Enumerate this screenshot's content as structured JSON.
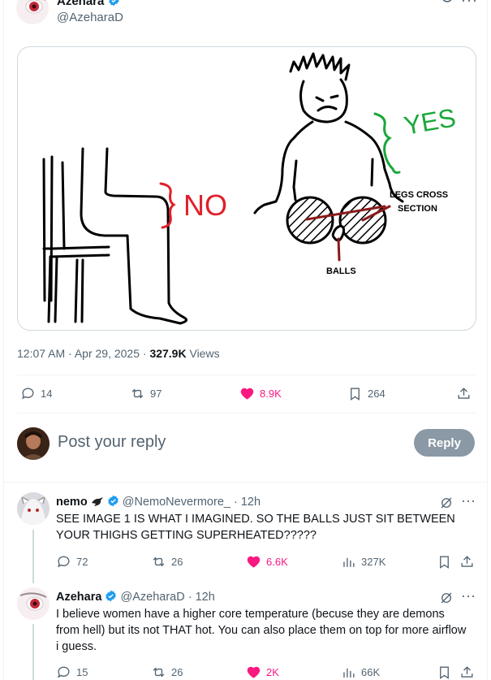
{
  "main_post": {
    "author_name": "Azehara",
    "author_handle": "@AzeharaD",
    "timestamp": "12:07 AM · Apr 29, 2025 · ",
    "views_count": "327.9K",
    "views_label": " Views",
    "actions": {
      "replies": "14",
      "reposts": "97",
      "likes": "8.9K",
      "bookmarks": "264"
    },
    "drawing_labels": {
      "no": "NO",
      "yes": "YES",
      "legs_cross_1": "LEGS CROSS",
      "legs_cross_2": "SECTION",
      "balls": "BALLS"
    }
  },
  "reply_composer": {
    "placeholder": "Post your reply",
    "button": "Reply"
  },
  "replies": [
    {
      "name": "nemo",
      "handle": "@NemoNevermore_",
      "time": "· 12h",
      "text": "SEE IMAGE 1 IS WHAT I IMAGINED. SO THE BALLS JUST SIT BETWEEN YOUR THIGHS GETTING SUPERHEATED?????",
      "replies": "72",
      "reposts": "26",
      "likes": "6.6K",
      "views": "327K"
    },
    {
      "name": "Azehara",
      "handle": "@AzeharaD",
      "time": "· 12h",
      "text": "I believe women have a higher core temperature (becuse they are demons from hell) but its not THAT hot.   You can also place them on top for more airflow i guess.",
      "replies": "15",
      "reposts": "26",
      "likes": "2K",
      "views": "66K"
    }
  ],
  "colors": {
    "accent": "#1d9bf0",
    "like": "#f91880",
    "reply_button": "#8b98a5",
    "no_red": "#e0202a",
    "yes_green": "#1aa83a",
    "dark_red": "#8b1a1a"
  },
  "icons": {
    "reply": "reply-icon",
    "repost": "repost-icon",
    "like": "heart-icon",
    "bookmark": "bookmark-icon",
    "share": "share-icon",
    "views": "views-icon",
    "grok": "grok-icon",
    "more": "more-icon",
    "verified": "verified-badge-icon"
  }
}
